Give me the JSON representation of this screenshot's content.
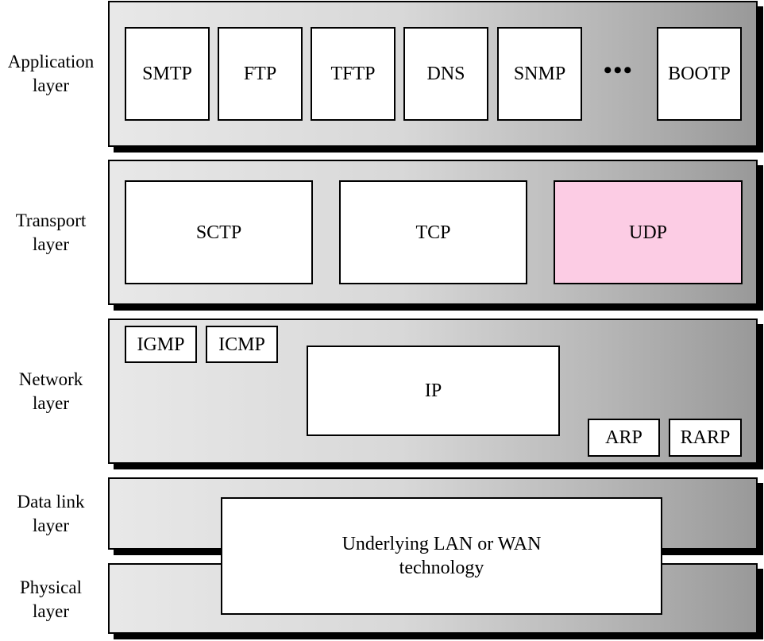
{
  "layers": {
    "application": {
      "label_line1": "Application",
      "label_line2": "layer",
      "protocols": [
        "SMTP",
        "FTP",
        "TFTP",
        "DNS",
        "SNMP",
        "BOOTP"
      ],
      "ellipsis": "•••"
    },
    "transport": {
      "label_line1": "Transport",
      "label_line2": "layer",
      "protocols": [
        "SCTP",
        "TCP",
        "UDP"
      ],
      "highlight": "UDP",
      "highlight_color": "#fccce4"
    },
    "network": {
      "label_line1": "Network",
      "label_line2": "layer",
      "protocols": [
        "IGMP",
        "ICMP",
        "IP",
        "ARP",
        "RARP"
      ]
    },
    "data_link": {
      "label_line1": "Data link",
      "label_line2": "layer"
    },
    "physical": {
      "label_line1": "Physical",
      "label_line2": "layer"
    }
  },
  "underlying": {
    "line1": "Underlying LAN or WAN",
    "line2": "technology"
  }
}
